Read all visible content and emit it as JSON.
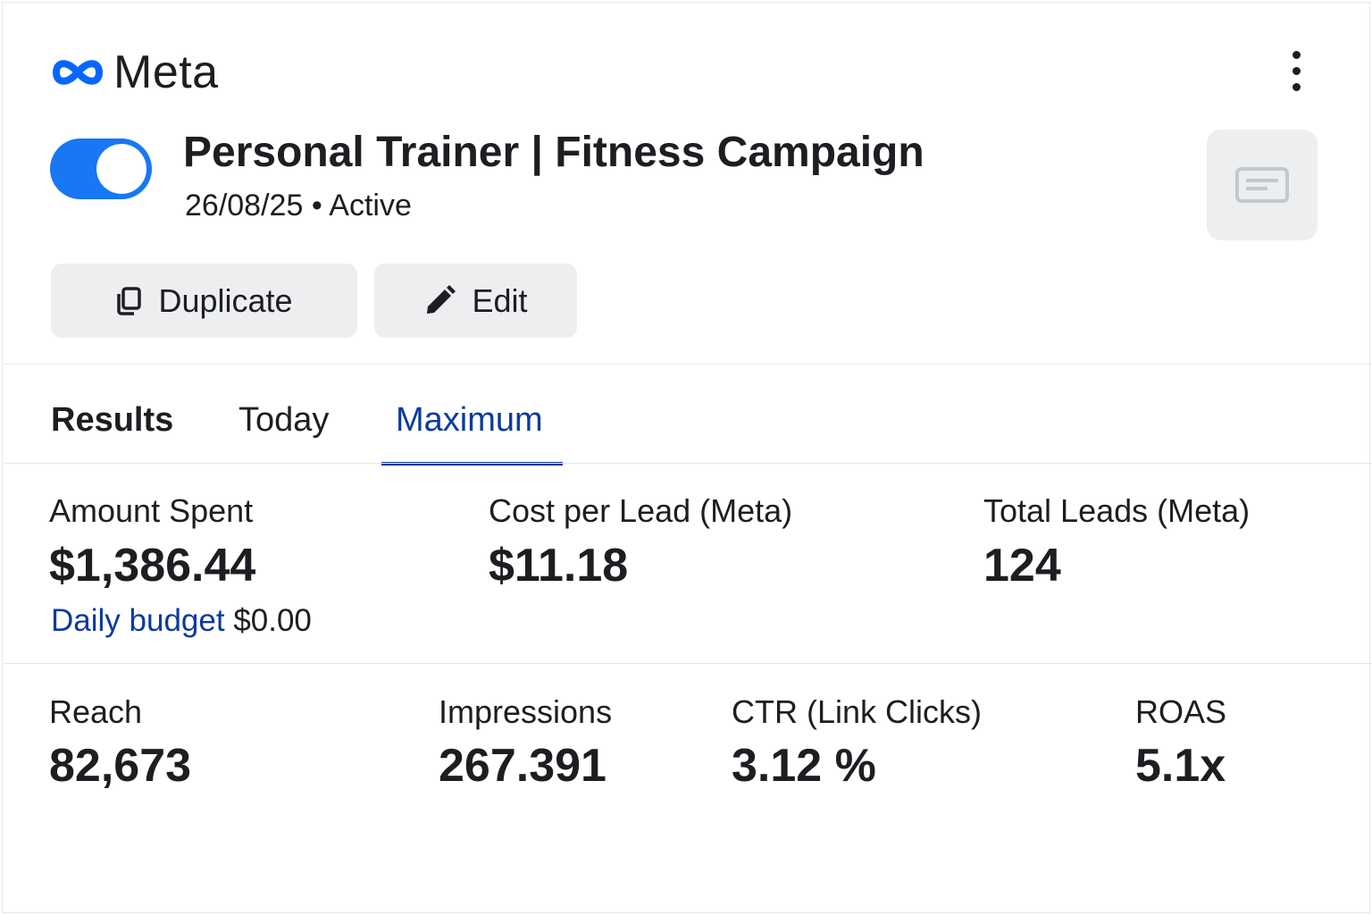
{
  "brand": {
    "name": "Meta",
    "color": "#0866ff"
  },
  "campaign": {
    "title": "Personal Trainer | Fitness Campaign",
    "date": "26/08/25",
    "separator": "•",
    "status": "Active",
    "toggle_on": true
  },
  "actions": {
    "duplicate_label": "Duplicate",
    "edit_label": "Edit"
  },
  "icons": {
    "menu": "kebab-menu-icon",
    "duplicate": "copy-icon",
    "edit": "pencil-icon",
    "ad_preview": "ad-preview-icon"
  },
  "tabs": [
    {
      "label": "Results"
    },
    {
      "label": "Today"
    },
    {
      "label": "Maximum",
      "selected": true
    }
  ],
  "metrics_primary": [
    {
      "label": "Amount Spent",
      "value": "$1,386.44"
    },
    {
      "label": "Cost per Lead (Meta)",
      "value": "$11.18"
    },
    {
      "label": "Total Leads (Meta)",
      "value": "124"
    }
  ],
  "budget": {
    "label": "Daily budget",
    "value": "$0.00"
  },
  "metrics_secondary": [
    {
      "label": "Reach",
      "value": "82,673"
    },
    {
      "label": "Impressions",
      "value": "267.391"
    },
    {
      "label": "CTR (Link Clicks)",
      "value": "3.12 %"
    },
    {
      "label": "ROAS",
      "value": "5.1x"
    }
  ],
  "colors": {
    "accent": "#1877f2",
    "tab_active": "#0b3a9e",
    "button_bg": "#eceef0"
  }
}
